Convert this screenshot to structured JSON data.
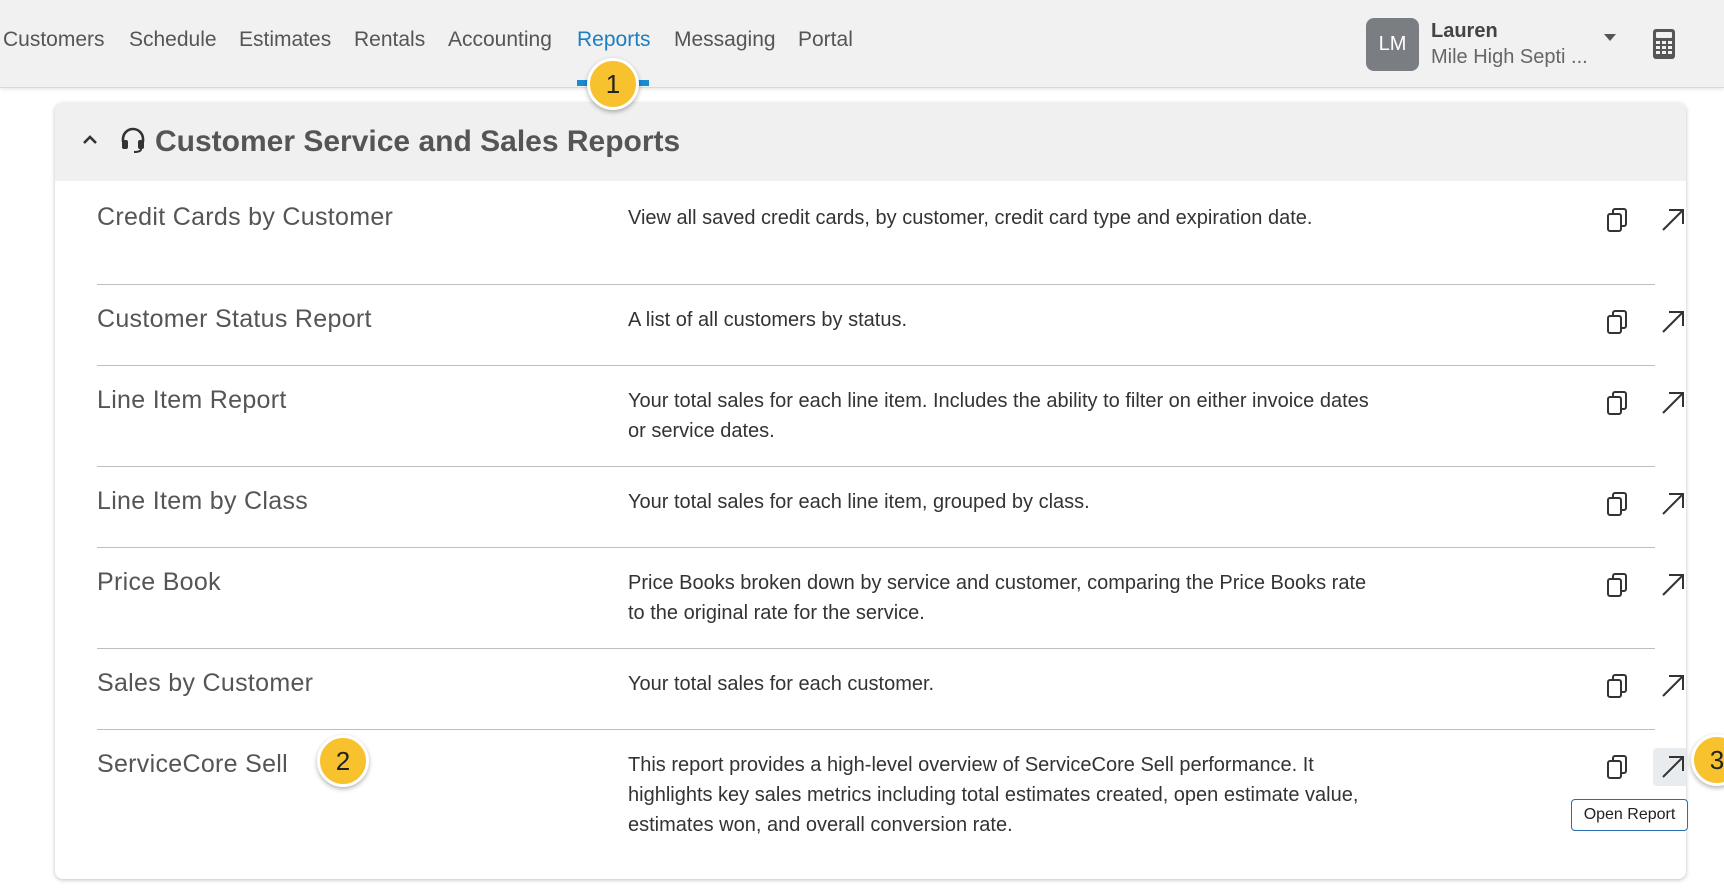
{
  "nav": {
    "items": [
      "Customers",
      "Schedule",
      "Estimates",
      "Rentals",
      "Accounting",
      "Reports",
      "Messaging",
      "Portal"
    ],
    "active": "Reports"
  },
  "user": {
    "initials": "LM",
    "name": "Lauren",
    "company": "Mile High Septi ..."
  },
  "section": {
    "title": "Customer Service and Sales Reports"
  },
  "reports": [
    {
      "name": "Credit Cards by Customer",
      "description": "View all saved credit cards, by customer, credit card type and expiration date."
    },
    {
      "name": "Customer Status Report",
      "description": "A list of all customers by status."
    },
    {
      "name": "Line Item Report",
      "description": "Your total sales for each line item. Includes the ability to filter on either invoice dates or service dates."
    },
    {
      "name": "Line Item by Class",
      "description": "Your total sales for each line item, grouped by class."
    },
    {
      "name": "Price Book",
      "description": "Price Books broken down by service and customer, comparing the Price Books rate to the original rate for the service."
    },
    {
      "name": "Sales by Customer",
      "description": "Your total sales for each customer."
    },
    {
      "name": "ServiceCore Sell",
      "description": "This report provides a high-level overview of ServiceCore Sell performance. It highlights key sales metrics including total estimates created, open estimate value, estimates won, and overall conversion rate."
    }
  ],
  "tooltip": "Open Report",
  "callouts": [
    "1",
    "2",
    "3"
  ],
  "colors": {
    "accent": "#1a7fc2",
    "callout": "#f8c12e"
  }
}
